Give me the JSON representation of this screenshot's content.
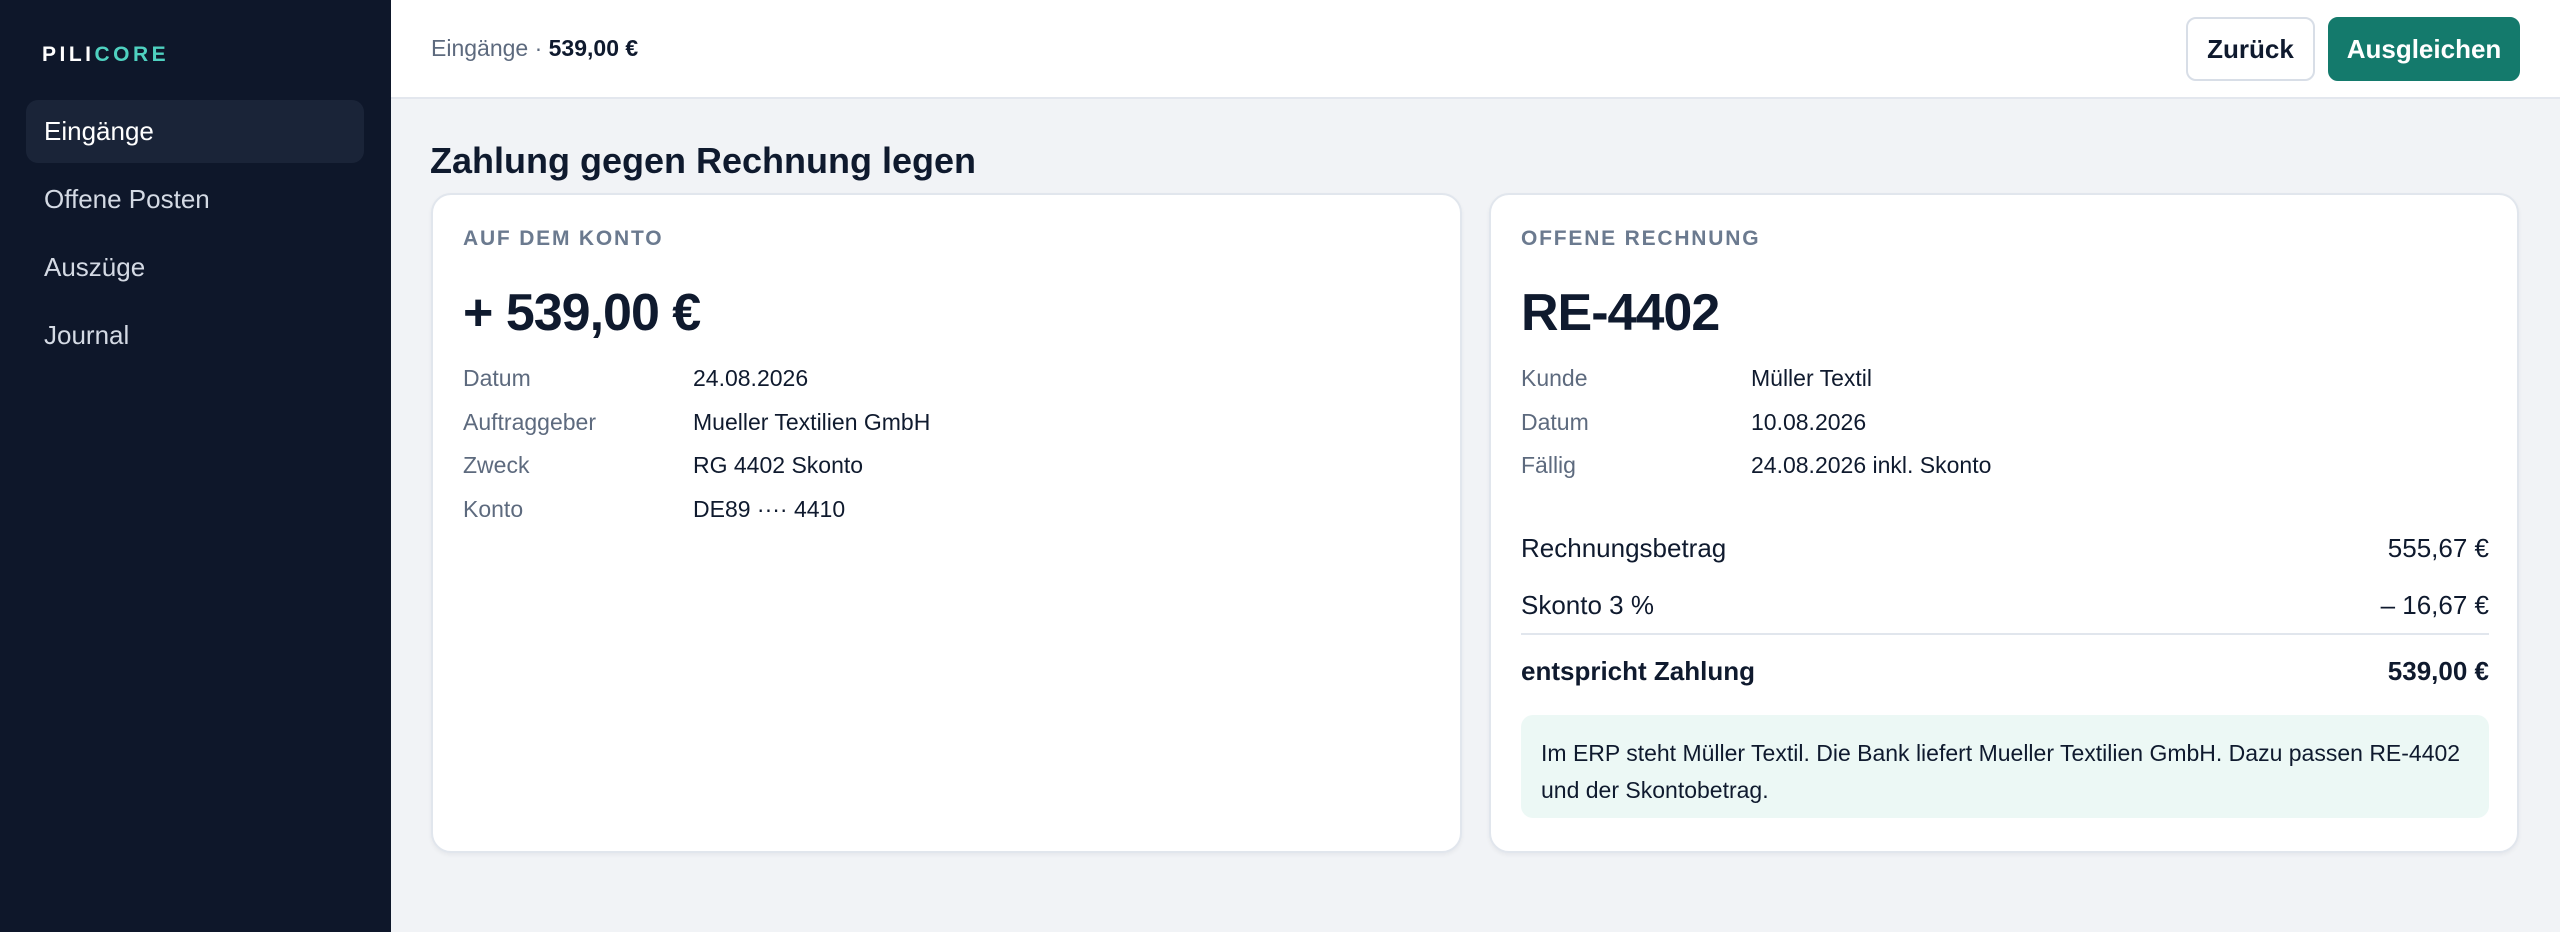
{
  "brand": {
    "part1": "PILI",
    "part2": "CORE",
    "accent_color": "#4fd1c0"
  },
  "sidebar": {
    "items": [
      {
        "label": "Eingänge",
        "active": true
      },
      {
        "label": "Offene Posten",
        "active": false
      },
      {
        "label": "Auszüge",
        "active": false
      },
      {
        "label": "Journal",
        "active": false
      }
    ]
  },
  "topbar": {
    "breadcrumb": "Eingänge · ",
    "amount": "539,00 €",
    "back_label": "Zurück",
    "primary_label": "Ausgleichen",
    "primary_color": "#147a6c"
  },
  "page": {
    "title": "Zahlung gegen Rechnung legen"
  },
  "account": {
    "label": "AUF DEM KONTO",
    "amount": "+ 539,00 €",
    "fields": [
      {
        "key": "Datum",
        "value": "24.08.2026"
      },
      {
        "key": "Auftraggeber",
        "value": "Mueller Textilien GmbH"
      },
      {
        "key": "Zweck",
        "value": "RG 4402 Skonto"
      },
      {
        "key": "Konto",
        "value": "DE89 ···· 4410"
      }
    ]
  },
  "invoice": {
    "label": "OFFENE RECHNUNG",
    "number": "RE-4402",
    "fields": [
      {
        "key": "Kunde",
        "value": "Müller Textil"
      },
      {
        "key": "Datum",
        "value": "10.08.2026"
      },
      {
        "key": "Fällig",
        "value": "24.08.2026 inkl. Skonto"
      }
    ],
    "lines": [
      {
        "label": "Rechnungsbetrag",
        "value": "555,67 €"
      },
      {
        "label": "Skonto 3 %",
        "value": "– 16,67 €"
      }
    ],
    "total": {
      "label": "entspricht Zahlung",
      "value": "539,00 €"
    },
    "note": "Im ERP steht Müller Textil. Die Bank liefert Mueller Textilien GmbH. Dazu passen RE-4402 und der Skontobetrag.",
    "note_color": "#ecf8f5"
  }
}
